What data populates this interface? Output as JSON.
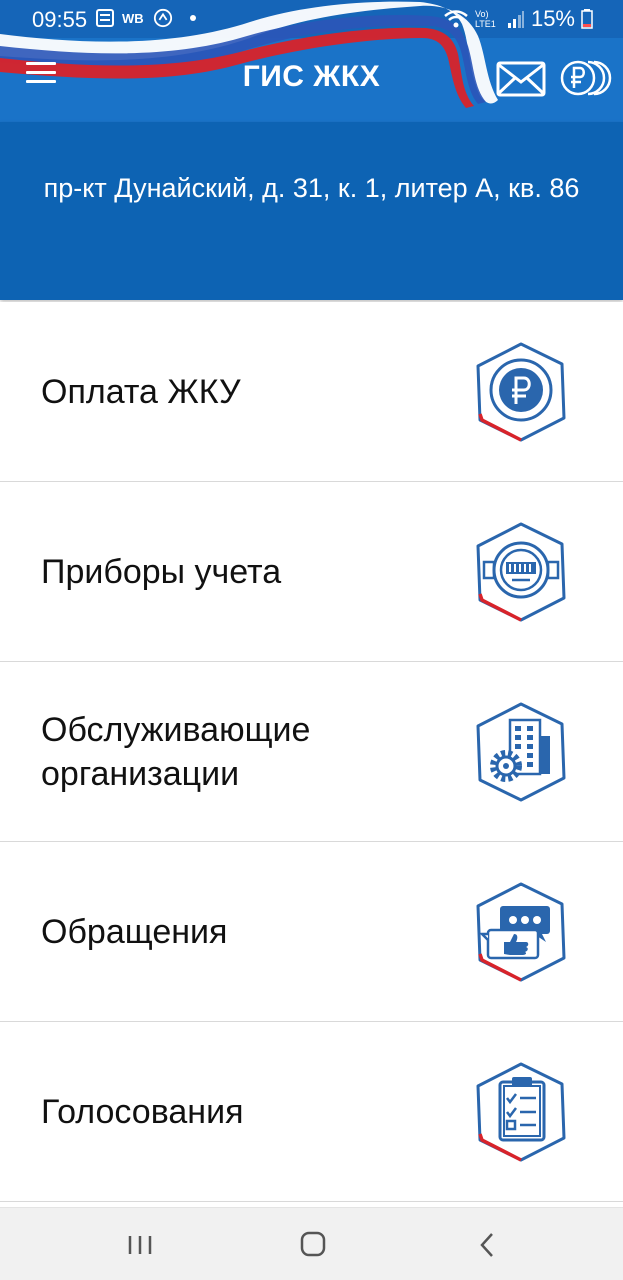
{
  "status_bar": {
    "time": "09:55",
    "carrier_tag": "WB",
    "network": "Vo) LTE1",
    "battery": "15%"
  },
  "app_bar": {
    "title": "ГИС ЖКХ",
    "icons": [
      "menu-icon",
      "mail-icon",
      "payments-icon"
    ]
  },
  "address": {
    "text": "пр-кт Дунайский, д. 31, к. 1, литер А, кв. 86"
  },
  "menu": {
    "items": [
      {
        "label": "Оплата ЖКУ",
        "icon": "ruble-coin-icon"
      },
      {
        "label": "Приборы учета",
        "icon": "meter-icon"
      },
      {
        "label": "Обслуживающие организации",
        "icon": "building-gear-icon"
      },
      {
        "label": "Обращения",
        "icon": "chat-like-icon"
      },
      {
        "label": "Голосования",
        "icon": "clipboard-checklist-icon"
      }
    ]
  },
  "colors": {
    "brand_blue": "#1a73c8",
    "address_blue": "#0d63b3",
    "icon_blue": "#2a66ad",
    "accent_red": "#d8232a"
  },
  "nav_bar": {
    "buttons": [
      "recents-button",
      "home-button",
      "back-button"
    ]
  }
}
